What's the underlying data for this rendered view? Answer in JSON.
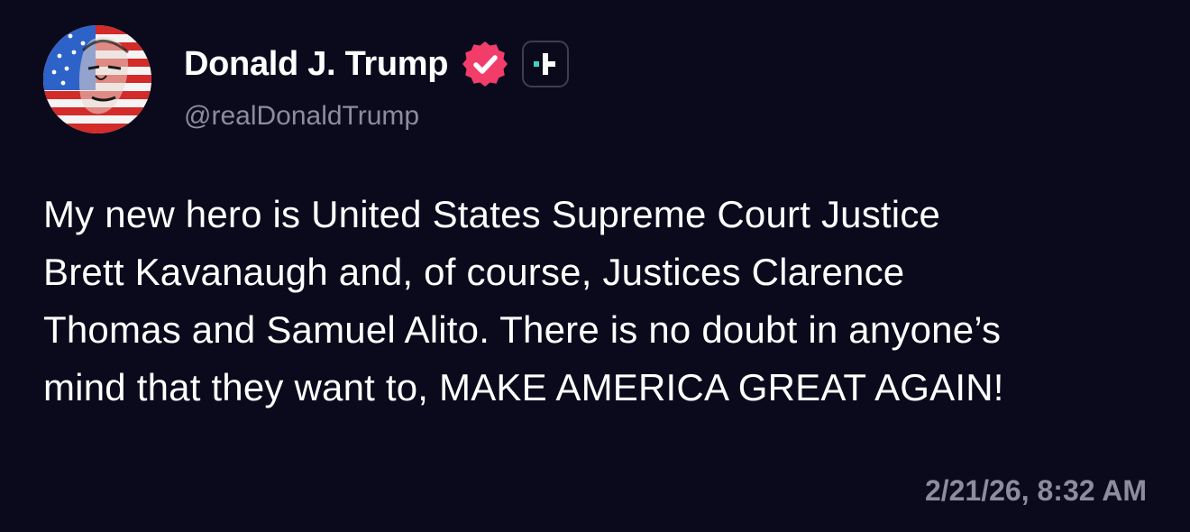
{
  "post": {
    "author": {
      "display_name": "Donald J. Trump",
      "handle": "@realDonaldTrump",
      "verified": true,
      "badges": [
        "verified-check-icon",
        "plus-badge-icon"
      ]
    },
    "body": "My new hero is United States Supreme Court Justice\nBrett Kavanaugh and, of course, Justices Clarence\nThomas and Samuel Alito. There is no doubt in anyone’s\nmind that they want to, MAKE AMERICA GREAT AGAIN!",
    "timestamp": "2/21/26, 8:32 AM"
  },
  "colors": {
    "background": "#0a0a1c",
    "text": "#ffffff",
    "muted": "#8d8c9e",
    "verified_badge": "#f23d6b",
    "plus_accent": "#3fd3c6"
  }
}
